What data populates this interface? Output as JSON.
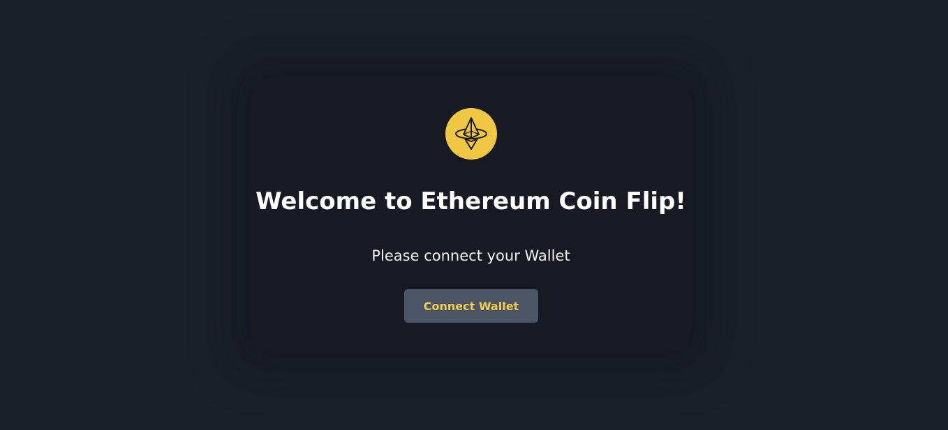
{
  "card": {
    "logo_icon": "ethereum-logo-icon",
    "title": "Welcome to Ethereum Coin Flip!",
    "subtitle": "Please connect your Wallet",
    "connect_button_label": "Connect Wallet"
  },
  "colors": {
    "background": "#1b1f2a",
    "card_background": "#171a22",
    "logo_circle": "#f0c743",
    "button_background": "#4b5565",
    "button_text": "#f5cf4b"
  }
}
